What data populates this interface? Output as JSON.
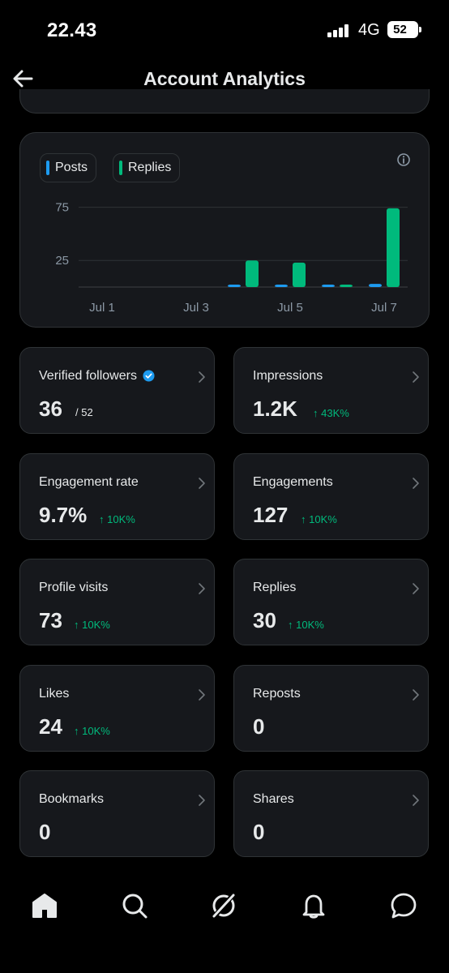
{
  "status_bar": {
    "time": "22.43",
    "network": "4G",
    "battery": "52"
  },
  "header": {
    "title": "Account Analytics"
  },
  "chart": {
    "legend": [
      {
        "label": "Posts",
        "color": "#1d9bf0"
      },
      {
        "label": "Replies",
        "color": "#00ba7c"
      }
    ],
    "y_ticks": [
      "75",
      "25"
    ],
    "x_ticks": [
      "Jul 1",
      "Jul 3",
      "Jul 5",
      "Jul 7"
    ]
  },
  "chart_data": {
    "type": "bar",
    "categories": [
      "Jul 1",
      "Jul 2",
      "Jul 3",
      "Jul 4",
      "Jul 5",
      "Jul 6",
      "Jul 7"
    ],
    "series": [
      {
        "name": "Posts",
        "values": [
          0,
          0,
          0,
          2,
          1,
          1,
          3
        ]
      },
      {
        "name": "Replies",
        "values": [
          0,
          0,
          0,
          25,
          23,
          2,
          74
        ]
      }
    ],
    "yticks": [
      25,
      75
    ],
    "ylim": [
      0,
      80
    ],
    "grid": true,
    "legend": "top-left"
  },
  "stats": [
    {
      "label": "Verified followers",
      "value": "36",
      "sub": "/ 52",
      "change": "",
      "verified": true
    },
    {
      "label": "Impressions",
      "value": "1.2K",
      "sub": "",
      "change": "↑ 43K%",
      "verified": false
    },
    {
      "label": "Engagement rate",
      "value": "9.7%",
      "sub": "",
      "change": "↑ 10K%",
      "verified": false
    },
    {
      "label": "Engagements",
      "value": "127",
      "sub": "",
      "change": "↑ 10K%",
      "verified": false
    },
    {
      "label": "Profile visits",
      "value": "73",
      "sub": "",
      "change": "↑ 10K%",
      "verified": false
    },
    {
      "label": "Replies",
      "value": "30",
      "sub": "",
      "change": "↑ 10K%",
      "verified": false
    },
    {
      "label": "Likes",
      "value": "24",
      "sub": "",
      "change": "↑ 10K%",
      "verified": false
    },
    {
      "label": "Reposts",
      "value": "0",
      "sub": "",
      "change": "",
      "verified": false
    },
    {
      "label": "Bookmarks",
      "value": "0",
      "sub": "",
      "change": "",
      "verified": false
    },
    {
      "label": "Shares",
      "value": "0",
      "sub": "",
      "change": "",
      "verified": false
    }
  ],
  "bottom_nav": {
    "items": [
      {
        "icon": "home-icon"
      },
      {
        "icon": "search-icon"
      },
      {
        "icon": "grok-icon"
      },
      {
        "icon": "bell-icon"
      },
      {
        "icon": "chat-icon"
      }
    ]
  }
}
